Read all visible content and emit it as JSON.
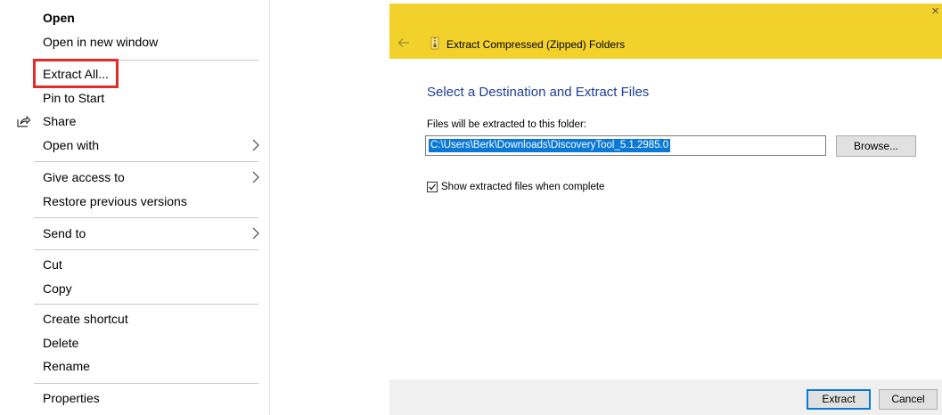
{
  "context_menu": {
    "items": {
      "open": "Open",
      "open_new_window": "Open in new window",
      "extract_all": "Extract All...",
      "pin_to_start": "Pin to Start",
      "share": "Share",
      "open_with": "Open with",
      "give_access_to": "Give access to",
      "restore_previous_versions": "Restore previous versions",
      "send_to": "Send to",
      "cut": "Cut",
      "copy": "Copy",
      "create_shortcut": "Create shortcut",
      "delete": "Delete",
      "rename": "Rename",
      "properties": "Properties"
    },
    "highlight_color": "#e22b2b"
  },
  "dialog": {
    "title": "Extract Compressed (Zipped) Folders",
    "close_glyph": "×",
    "heading": "Select a Destination and Extract Files",
    "folder_label": "Files will be extracted to this folder:",
    "path_value": "C:\\Users\\Berk\\Downloads\\DiscoveryTool_5.1.2985.0",
    "browse_label": "Browse...",
    "show_files_label": "Show extracted files when complete",
    "show_files_checked": true,
    "extract_label": "Extract",
    "cancel_label": "Cancel",
    "titlebar_color": "#f2d22a",
    "heading_color": "#1e3e9a",
    "selection_color": "#0a78d7"
  }
}
